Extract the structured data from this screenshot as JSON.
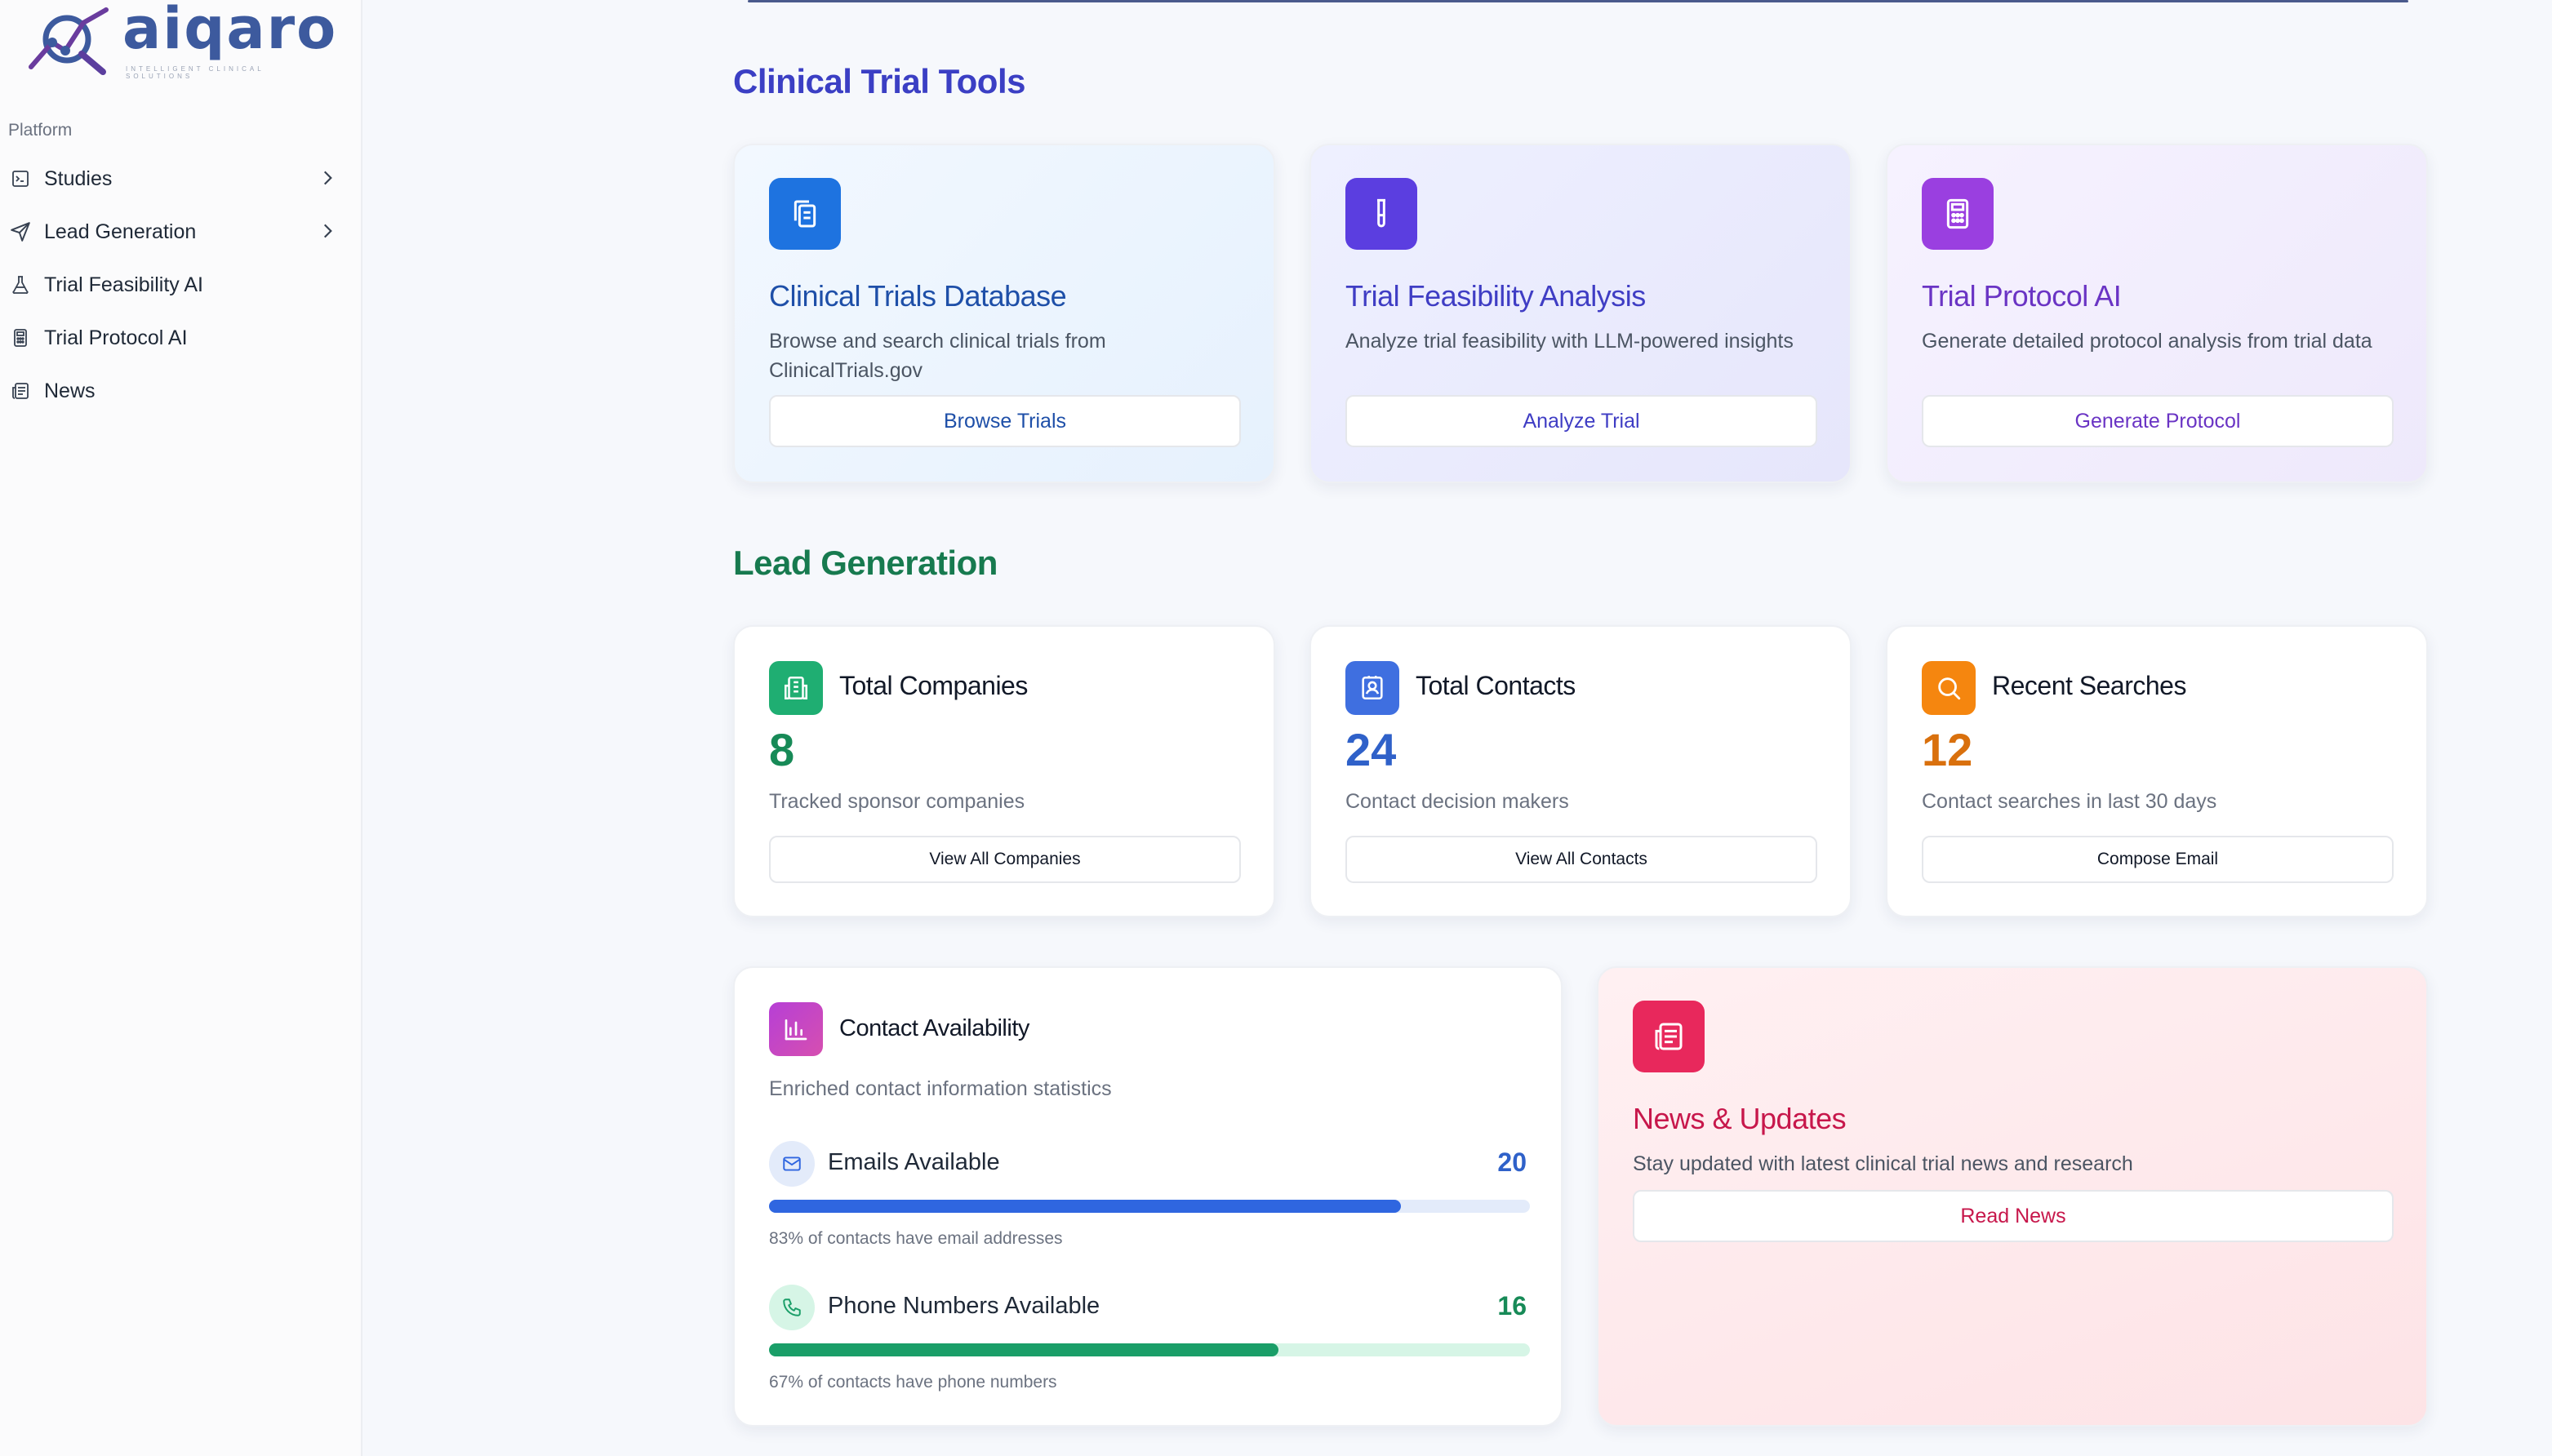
{
  "brand": {
    "name": "aiqaro",
    "tagline": "INTELLIGENT CLINICAL SOLUTIONS"
  },
  "sidebar": {
    "section_label": "Platform",
    "items": [
      {
        "label": "Studies",
        "icon": "studies-icon",
        "has_submenu": true
      },
      {
        "label": "Lead Generation",
        "icon": "send-icon",
        "has_submenu": true
      },
      {
        "label": "Trial Feasibility AI",
        "icon": "flask-icon",
        "has_submenu": false
      },
      {
        "label": "Trial Protocol AI",
        "icon": "calculator-icon",
        "has_submenu": false
      },
      {
        "label": "News",
        "icon": "newspaper-icon",
        "has_submenu": false
      }
    ]
  },
  "tools_section": {
    "title": "Clinical Trial Tools",
    "title_color": "#3b3fc4",
    "cards": [
      {
        "title": "Clinical Trials Database",
        "description": "Browse and search clinical trials from ClinicalTrials.gov",
        "button": "Browse Trials",
        "icon": "copy-icon",
        "accent": "#1e73e0",
        "title_color": "#1e4fa8"
      },
      {
        "title": "Trial Feasibility Analysis",
        "description": "Analyze trial feasibility with LLM-powered insights",
        "button": "Analyze Trial",
        "icon": "test-tube-icon",
        "accent": "#5b3ee0",
        "title_color": "#3f3dc4"
      },
      {
        "title": "Trial Protocol AI",
        "description": "Generate detailed protocol analysis from trial data",
        "button": "Generate Protocol",
        "icon": "calculator-icon",
        "accent": "#9a3fe0",
        "title_color": "#6a34c4"
      }
    ]
  },
  "lead_section": {
    "title": "Lead Generation",
    "title_color": "#177a4f",
    "stats": [
      {
        "title": "Total Companies",
        "value": "8",
        "description": "Tracked sponsor companies",
        "button": "View All Companies",
        "icon": "building-icon",
        "accent": "#1fae72",
        "value_color": "#178a57"
      },
      {
        "title": "Total Contacts",
        "value": "24",
        "description": "Contact decision makers",
        "button": "View All Contacts",
        "icon": "contact-card-icon",
        "accent": "#3f6fe0",
        "value_color": "#2f61c9"
      },
      {
        "title": "Recent Searches",
        "value": "12",
        "description": "Contact searches in last 30 days",
        "button": "Compose Email",
        "icon": "search-icon",
        "accent": "#f5860f",
        "value_color": "#d9700d"
      }
    ]
  },
  "availability": {
    "title": "Contact Availability",
    "subtitle": "Enriched contact information statistics",
    "rows": [
      {
        "label": "Emails Available",
        "value": "20",
        "percent": 83,
        "note": "83% of contacts have email addresses",
        "icon": "mail-icon",
        "color": "#2f66e0",
        "track": "#e3ebfa",
        "value_color": "#2f61c9"
      },
      {
        "label": "Phone Numbers Available",
        "value": "16",
        "percent": 67,
        "note": "67% of contacts have phone numbers",
        "icon": "phone-icon",
        "color": "#1a9e68",
        "track": "#d6f5e6",
        "value_color": "#178a57"
      }
    ]
  },
  "news": {
    "title": "News & Updates",
    "description": "Stay updated with latest clinical trial news and research",
    "button": "Read News",
    "icon": "newspaper-icon",
    "accent": "#e8285c",
    "title_color": "#c7174b"
  }
}
